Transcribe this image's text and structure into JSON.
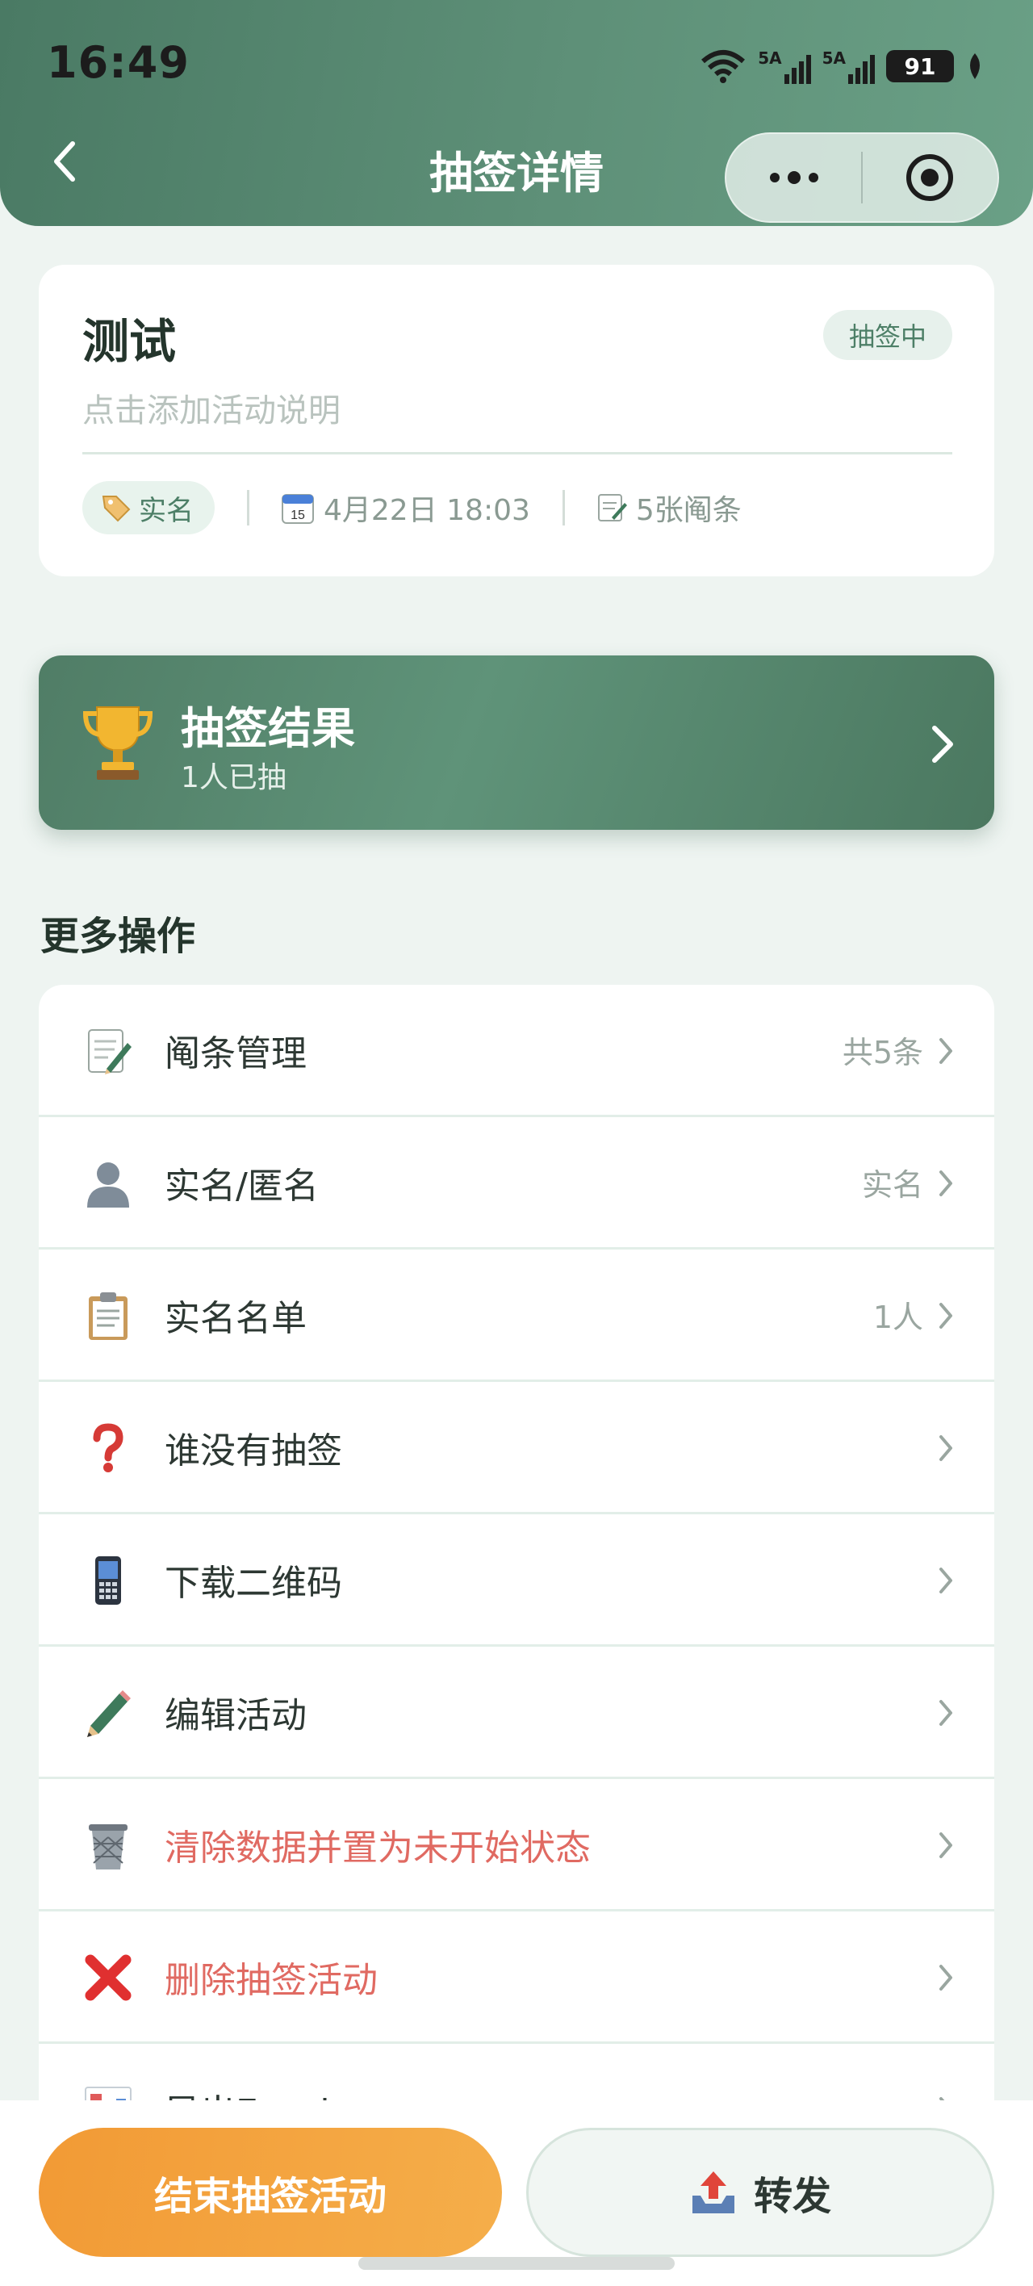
{
  "status_bar": {
    "time": "16:49",
    "network1": "5A",
    "network2": "5A",
    "battery": "91"
  },
  "nav": {
    "title": "抽签详情"
  },
  "activity": {
    "title": "测试",
    "status": "抽签中",
    "description_placeholder": "点击添加活动说明",
    "tag": "实名",
    "date": "4月22日 18:03",
    "slips": "5张阄条"
  },
  "result": {
    "title": "抽签结果",
    "subtitle": "1人已抽"
  },
  "section": {
    "title": "更多操作"
  },
  "operations": [
    {
      "label": "阄条管理",
      "value": "共5条",
      "icon": "memo-icon"
    },
    {
      "label": "实名/匿名",
      "value": "实名",
      "icon": "user-silhouette-icon"
    },
    {
      "label": "实名名单",
      "value": "1人",
      "icon": "clipboard-icon"
    },
    {
      "label": "谁没有抽签",
      "value": "",
      "icon": "question-icon"
    },
    {
      "label": "下载二维码",
      "value": "",
      "icon": "phone-icon"
    },
    {
      "label": "编辑活动",
      "value": "",
      "icon": "pencil-icon"
    },
    {
      "label": "清除数据并置为未开始状态",
      "value": "",
      "icon": "trash-icon",
      "danger": true
    },
    {
      "label": "删除抽签活动",
      "value": "",
      "icon": "cross-icon",
      "danger": true
    },
    {
      "label": "导出Excel",
      "value": "",
      "icon": "spreadsheet-icon"
    }
  ],
  "bottom": {
    "end_label": "结束抽签活动",
    "share_label": "转发"
  },
  "colors": {
    "accent_green": "#5e9078",
    "orange": "#f29a35",
    "danger": "#e06a62"
  }
}
